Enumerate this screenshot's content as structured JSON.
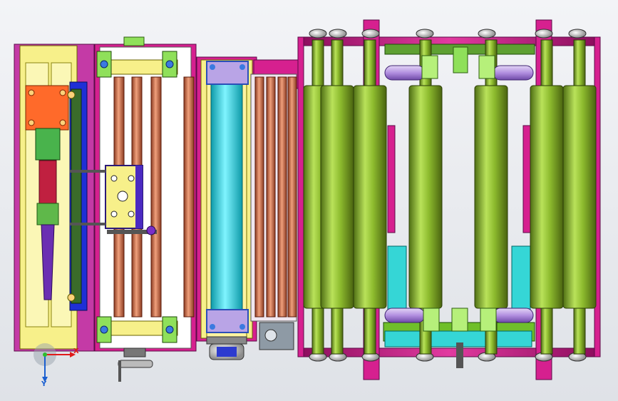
{
  "viewport": {
    "view": "top",
    "background": "#e6e8ec"
  },
  "triad": {
    "x_label": "X",
    "y_label": "Y",
    "colors": {
      "x": "#e01a1a",
      "y": "#1a5fd0",
      "origin": "#2dbd2d"
    }
  },
  "palette": {
    "frame_magenta": "#d6208f",
    "frame_dark": "#8a0d5c",
    "panel_yellow": "#f7f08a",
    "roller_green": "#9ac63a",
    "roller_green_dark": "#4f6f14",
    "tube_copper": "#d77a55",
    "tube_cyan": "#29d8e8",
    "bracket_cyan": "#35d6d6",
    "bracket_lime": "#8fe05a",
    "block_orange": "#ff6a2a",
    "plate_purple": "#7a2fc9",
    "idler_lilac": "#b79ae0",
    "bearing_grey": "#c9c9c9"
  }
}
